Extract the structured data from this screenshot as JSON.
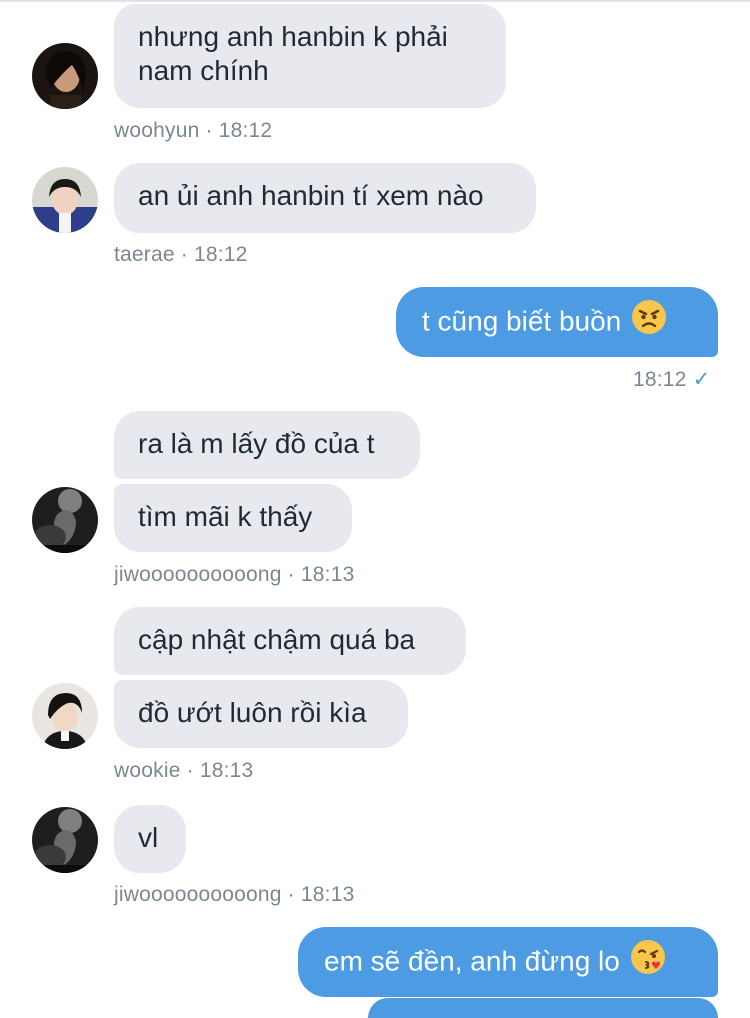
{
  "messages": [
    {
      "id": 1,
      "direction": "incoming",
      "sender": "woohyun",
      "time": "18:12",
      "lines": [
        "nhưng anh hanbin k phải",
        "nam chính"
      ]
    },
    {
      "id": 2,
      "direction": "incoming",
      "sender": "taerae",
      "time": "18:12",
      "lines": [
        "an ủi anh hanbin tí xem nào"
      ]
    },
    {
      "id": 3,
      "direction": "outgoing",
      "time": "18:12",
      "text": "t cũng biết buồn",
      "emoji": "angry-face-emoji",
      "status": "sent-check"
    },
    {
      "id": 4,
      "direction": "incoming",
      "sender": "jiwoooooooooong",
      "time": "18:13",
      "group": [
        "ra là m lấy đồ của t",
        "tìm mãi k thấy"
      ]
    },
    {
      "id": 5,
      "direction": "incoming",
      "sender": "wookie",
      "time": "18:13",
      "group": [
        "cập nhật chậm quá ba",
        "đồ ướt luôn rồi kìa"
      ]
    },
    {
      "id": 6,
      "direction": "incoming",
      "sender": "jiwoooooooooong",
      "time": "18:13",
      "lines": [
        "vl"
      ]
    },
    {
      "id": 7,
      "direction": "outgoing",
      "text": "em sẽ đền, anh đừng lo",
      "emoji": "kissing-face-emoji"
    }
  ],
  "meta": {
    "woohyun": "woohyun · 18:12",
    "taerae": "taerae · 18:12",
    "out_time": "18:12",
    "jiwoo1": "jiwoooooooooong · 18:13",
    "wookie": "wookie · 18:13",
    "jiwoo2": "jiwoooooooooong · 18:13"
  },
  "colors": {
    "incoming_bubble": "#e7e9ee",
    "outgoing_bubble": "#4c9be3",
    "meta_text": "#7b8792",
    "check": "#4c9be3"
  }
}
